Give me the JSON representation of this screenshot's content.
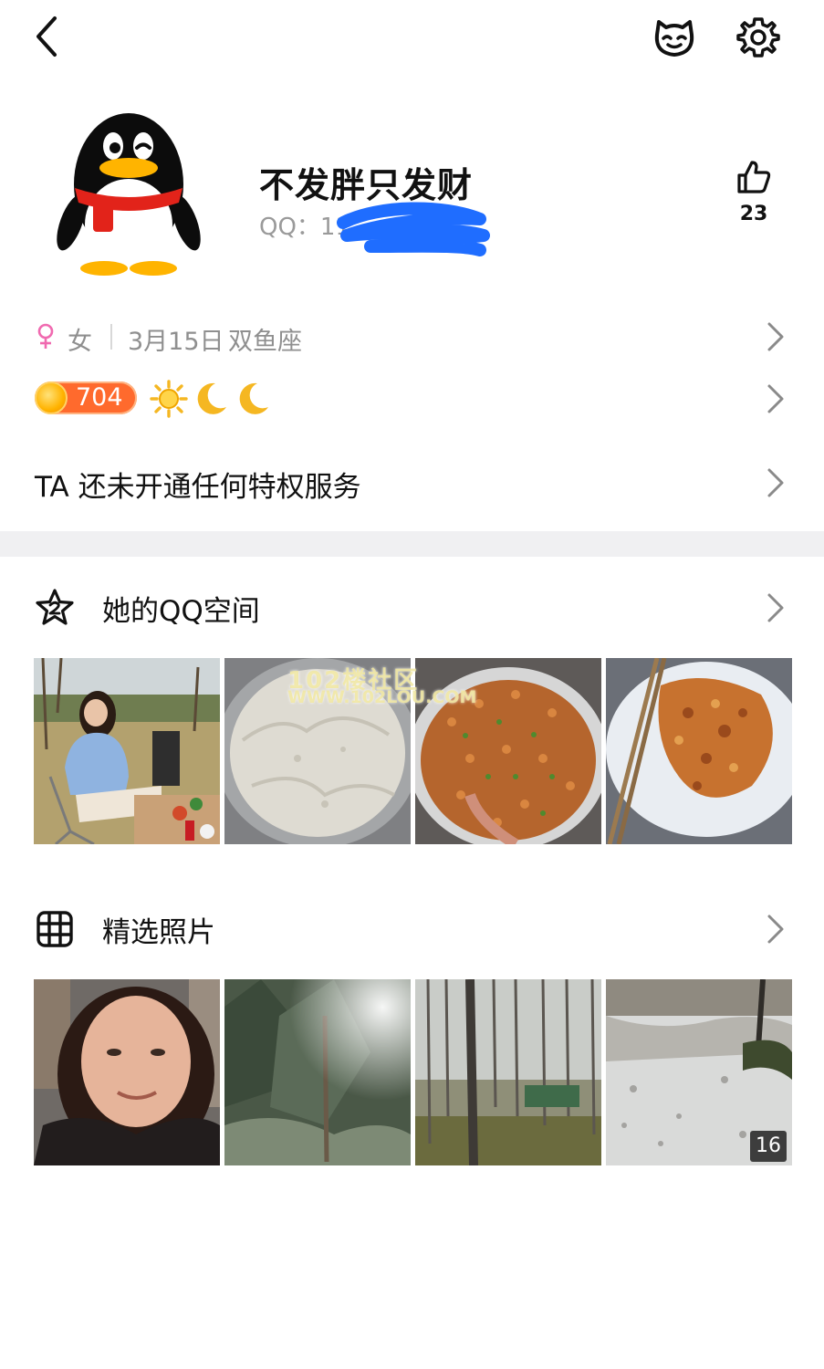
{
  "header": {
    "back_icon": "chevron-left-icon",
    "mascot_icon": "pet-face-icon",
    "settings_icon": "gear-icon"
  },
  "profile": {
    "avatar_icon": "qq-penguin-avatar",
    "nickname": "不发胖只发财",
    "qq_label": "QQ：11",
    "qq_redacted": true,
    "likes": "23"
  },
  "info": {
    "gender_icon": "female-symbol-icon",
    "gender": "女",
    "birthday": "3月15日",
    "zodiac": "双鱼座"
  },
  "level": {
    "value": "704",
    "icons": [
      "sun-icon",
      "moon-icon",
      "moon-icon"
    ]
  },
  "privilege": {
    "text": "TA 还未开通任何特权服务"
  },
  "qzone": {
    "title": "她的QQ空间",
    "icon": "star-2-icon",
    "photos": [
      "woman-picnic-photo",
      "dough-photo",
      "stir-fry-photo",
      "fried-chicken-photo"
    ],
    "watermark_line1": "102楼社区",
    "watermark_line2": "WWW.102LOU.COM"
  },
  "featured": {
    "title": "精选照片",
    "icon": "grid-icon",
    "photos": [
      "selfie-photo",
      "pine-tree-photo",
      "poplar-grove-photo",
      "frosty-ground-photo"
    ],
    "count": "16"
  },
  "colors": {
    "accent_level": "#ff6a2d",
    "gender_pink": "#f06ab0",
    "moon_yellow": "#f5b722",
    "text_muted": "#8f8f8f",
    "redact_blue": "#1f6dff"
  }
}
